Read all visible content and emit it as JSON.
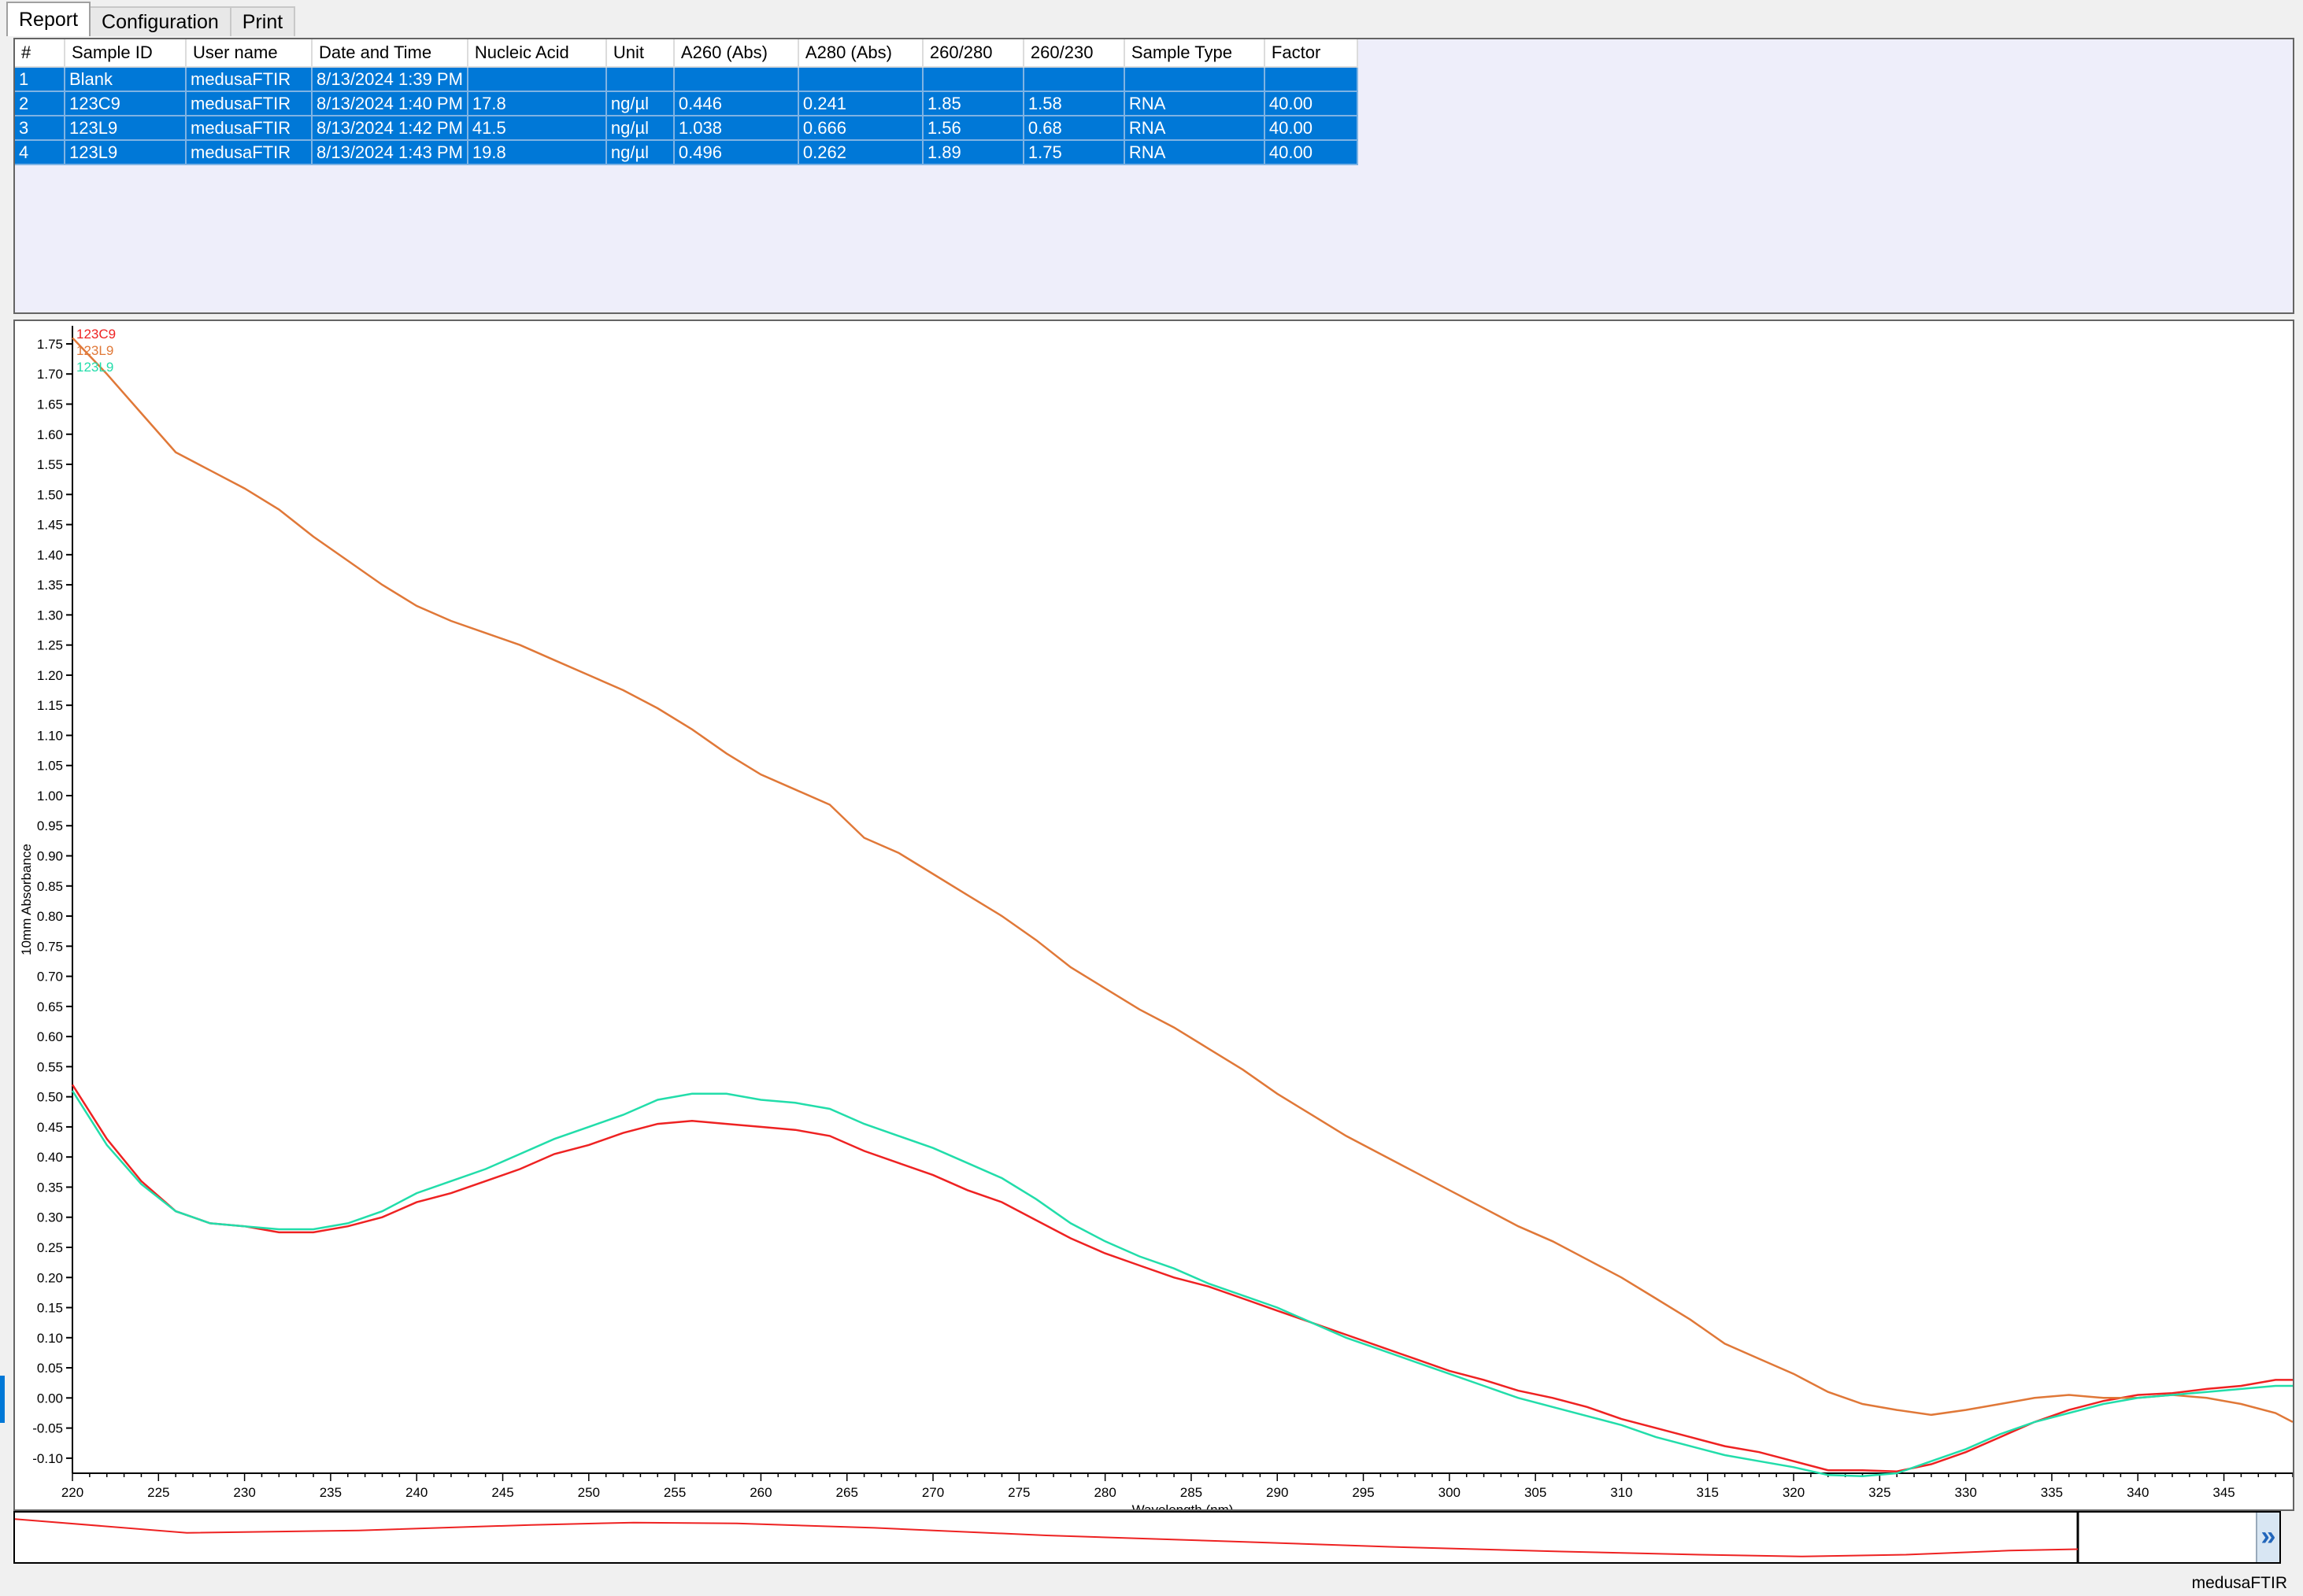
{
  "tabs": [
    {
      "label": "Report",
      "active": true
    },
    {
      "label": "Configuration",
      "active": false
    },
    {
      "label": "Print",
      "active": false
    }
  ],
  "table": {
    "columns": [
      "#",
      "Sample ID",
      "User name",
      "Date and Time",
      "Nucleic Acid",
      "Unit",
      "A260 (Abs)",
      "A280 (Abs)",
      "260/280",
      "260/230",
      "Sample Type",
      "Factor"
    ],
    "rows": [
      [
        "1",
        "Blank",
        "medusaFTIR",
        "8/13/2024 1:39 PM",
        "",
        "",
        "",
        "",
        "",
        "",
        "",
        ""
      ],
      [
        "2",
        "123C9",
        "medusaFTIR",
        "8/13/2024 1:40 PM",
        "17.8",
        "ng/µl",
        "0.446",
        "0.241",
        "1.85",
        "1.58",
        "RNA",
        "40.00"
      ],
      [
        "3",
        "123L9",
        "medusaFTIR",
        "8/13/2024 1:42 PM",
        "41.5",
        "ng/µl",
        "1.038",
        "0.666",
        "1.56",
        "0.68",
        "RNA",
        "40.00"
      ],
      [
        "4",
        "123L9",
        "medusaFTIR",
        "8/13/2024 1:43 PM",
        "19.8",
        "ng/µl",
        "0.496",
        "0.262",
        "1.89",
        "1.75",
        "RNA",
        "40.00"
      ]
    ]
  },
  "chart_data": {
    "type": "line",
    "xlabel": "Wavelength (nm)",
    "ylabel": "10mm Absorbance",
    "xlim": [
      220,
      349
    ],
    "ylim": [
      -0.125,
      1.78
    ],
    "xticks": [
      220,
      225,
      230,
      235,
      240,
      245,
      250,
      255,
      260,
      265,
      270,
      275,
      280,
      285,
      290,
      295,
      300,
      305,
      310,
      315,
      320,
      325,
      330,
      335,
      340,
      345
    ],
    "yticks": [
      -0.1,
      -0.05,
      0,
      0.05,
      0.1,
      0.15,
      0.2,
      0.25,
      0.3,
      0.35,
      0.4,
      0.45,
      0.5,
      0.55,
      0.6,
      0.65,
      0.7,
      0.75,
      0.8,
      0.85,
      0.9,
      0.95,
      1.0,
      1.05,
      1.1,
      1.15,
      1.2,
      1.25,
      1.3,
      1.35,
      1.4,
      1.45,
      1.5,
      1.55,
      1.6,
      1.65,
      1.7,
      1.75
    ],
    "grid": false,
    "legend": "top-left",
    "series": [
      {
        "name": "123C9",
        "color": "#ee2222",
        "points": [
          [
            220,
            0.52
          ],
          [
            222,
            0.43
          ],
          [
            224,
            0.36
          ],
          [
            226,
            0.31
          ],
          [
            228,
            0.29
          ],
          [
            230,
            0.285
          ],
          [
            232,
            0.275
          ],
          [
            234,
            0.275
          ],
          [
            236,
            0.285
          ],
          [
            238,
            0.3
          ],
          [
            240,
            0.325
          ],
          [
            242,
            0.34
          ],
          [
            244,
            0.36
          ],
          [
            246,
            0.38
          ],
          [
            248,
            0.405
          ],
          [
            250,
            0.42
          ],
          [
            252,
            0.44
          ],
          [
            254,
            0.455
          ],
          [
            256,
            0.46
          ],
          [
            258,
            0.455
          ],
          [
            260,
            0.45
          ],
          [
            262,
            0.445
          ],
          [
            264,
            0.435
          ],
          [
            266,
            0.41
          ],
          [
            268,
            0.39
          ],
          [
            270,
            0.37
          ],
          [
            272,
            0.345
          ],
          [
            274,
            0.325
          ],
          [
            276,
            0.295
          ],
          [
            278,
            0.265
          ],
          [
            280,
            0.24
          ],
          [
            282,
            0.22
          ],
          [
            284,
            0.2
          ],
          [
            286,
            0.185
          ],
          [
            288,
            0.165
          ],
          [
            290,
            0.145
          ],
          [
            292,
            0.125
          ],
          [
            294,
            0.105
          ],
          [
            296,
            0.085
          ],
          [
            298,
            0.065
          ],
          [
            300,
            0.045
          ],
          [
            302,
            0.03
          ],
          [
            304,
            0.012
          ],
          [
            306,
            0.0
          ],
          [
            308,
            -0.015
          ],
          [
            310,
            -0.035
          ],
          [
            312,
            -0.05
          ],
          [
            314,
            -0.065
          ],
          [
            316,
            -0.08
          ],
          [
            318,
            -0.09
          ],
          [
            320,
            -0.105
          ],
          [
            322,
            -0.12
          ],
          [
            324,
            -0.12
          ],
          [
            326,
            -0.122
          ],
          [
            328,
            -0.11
          ],
          [
            330,
            -0.09
          ],
          [
            332,
            -0.065
          ],
          [
            334,
            -0.04
          ],
          [
            336,
            -0.02
          ],
          [
            338,
            -0.005
          ],
          [
            340,
            0.005
          ],
          [
            342,
            0.008
          ],
          [
            344,
            0.015
          ],
          [
            346,
            0.02
          ],
          [
            348,
            0.03
          ],
          [
            349,
            0.03
          ]
        ]
      },
      {
        "name": "123L9",
        "color": "#e07838",
        "points": [
          [
            220,
            1.76
          ],
          [
            222,
            1.7
          ],
          [
            224,
            1.635
          ],
          [
            226,
            1.57
          ],
          [
            228,
            1.54
          ],
          [
            230,
            1.51
          ],
          [
            232,
            1.475
          ],
          [
            234,
            1.43
          ],
          [
            236,
            1.39
          ],
          [
            238,
            1.35
          ],
          [
            240,
            1.315
          ],
          [
            242,
            1.29
          ],
          [
            244,
            1.27
          ],
          [
            246,
            1.25
          ],
          [
            248,
            1.225
          ],
          [
            250,
            1.2
          ],
          [
            252,
            1.175
          ],
          [
            254,
            1.145
          ],
          [
            256,
            1.11
          ],
          [
            258,
            1.07
          ],
          [
            260,
            1.035
          ],
          [
            262,
            1.01
          ],
          [
            264,
            0.985
          ],
          [
            266,
            0.93
          ],
          [
            268,
            0.905
          ],
          [
            270,
            0.87
          ],
          [
            272,
            0.835
          ],
          [
            274,
            0.8
          ],
          [
            276,
            0.76
          ],
          [
            278,
            0.715
          ],
          [
            280,
            0.68
          ],
          [
            282,
            0.645
          ],
          [
            284,
            0.615
          ],
          [
            286,
            0.58
          ],
          [
            288,
            0.545
          ],
          [
            290,
            0.505
          ],
          [
            292,
            0.47
          ],
          [
            294,
            0.435
          ],
          [
            296,
            0.405
          ],
          [
            298,
            0.375
          ],
          [
            300,
            0.345
          ],
          [
            302,
            0.315
          ],
          [
            304,
            0.285
          ],
          [
            306,
            0.26
          ],
          [
            308,
            0.23
          ],
          [
            310,
            0.2
          ],
          [
            312,
            0.165
          ],
          [
            314,
            0.13
          ],
          [
            316,
            0.09
          ],
          [
            318,
            0.065
          ],
          [
            320,
            0.04
          ],
          [
            322,
            0.01
          ],
          [
            324,
            -0.01
          ],
          [
            326,
            -0.02
          ],
          [
            328,
            -0.028
          ],
          [
            330,
            -0.02
          ],
          [
            332,
            -0.01
          ],
          [
            334,
            0.0
          ],
          [
            336,
            0.005
          ],
          [
            338,
            0.0
          ],
          [
            340,
            0.0
          ],
          [
            342,
            0.005
          ],
          [
            344,
            0.0
          ],
          [
            346,
            -0.01
          ],
          [
            348,
            -0.025
          ],
          [
            349,
            -0.04
          ]
        ]
      },
      {
        "name": "123L9",
        "color": "#22ddaa",
        "points": [
          [
            220,
            0.51
          ],
          [
            222,
            0.42
          ],
          [
            224,
            0.355
          ],
          [
            226,
            0.31
          ],
          [
            228,
            0.29
          ],
          [
            230,
            0.285
          ],
          [
            232,
            0.28
          ],
          [
            234,
            0.28
          ],
          [
            236,
            0.29
          ],
          [
            238,
            0.31
          ],
          [
            240,
            0.34
          ],
          [
            242,
            0.36
          ],
          [
            244,
            0.38
          ],
          [
            246,
            0.405
          ],
          [
            248,
            0.43
          ],
          [
            250,
            0.45
          ],
          [
            252,
            0.47
          ],
          [
            254,
            0.495
          ],
          [
            256,
            0.505
          ],
          [
            258,
            0.505
          ],
          [
            260,
            0.495
          ],
          [
            262,
            0.49
          ],
          [
            264,
            0.48
          ],
          [
            266,
            0.455
          ],
          [
            268,
            0.435
          ],
          [
            270,
            0.415
          ],
          [
            272,
            0.39
          ],
          [
            274,
            0.365
          ],
          [
            276,
            0.33
          ],
          [
            278,
            0.29
          ],
          [
            280,
            0.26
          ],
          [
            282,
            0.235
          ],
          [
            284,
            0.215
          ],
          [
            286,
            0.19
          ],
          [
            288,
            0.17
          ],
          [
            290,
            0.15
          ],
          [
            292,
            0.125
          ],
          [
            294,
            0.1
          ],
          [
            296,
            0.08
          ],
          [
            298,
            0.06
          ],
          [
            300,
            0.04
          ],
          [
            302,
            0.02
          ],
          [
            304,
            0.0
          ],
          [
            306,
            -0.015
          ],
          [
            308,
            -0.03
          ],
          [
            310,
            -0.045
          ],
          [
            312,
            -0.065
          ],
          [
            314,
            -0.08
          ],
          [
            316,
            -0.095
          ],
          [
            318,
            -0.105
          ],
          [
            320,
            -0.115
          ],
          [
            322,
            -0.128
          ],
          [
            324,
            -0.13
          ],
          [
            326,
            -0.125
          ],
          [
            328,
            -0.105
          ],
          [
            330,
            -0.085
          ],
          [
            332,
            -0.06
          ],
          [
            334,
            -0.04
          ],
          [
            336,
            -0.025
          ],
          [
            338,
            -0.01
          ],
          [
            340,
            0.0
          ],
          [
            342,
            0.005
          ],
          [
            344,
            0.01
          ],
          [
            346,
            0.015
          ],
          [
            348,
            0.02
          ],
          [
            349,
            0.02
          ]
        ]
      }
    ]
  },
  "overview": {
    "color": "#ee2222",
    "points": [
      [
        220,
        0.52
      ],
      [
        230,
        0.285
      ],
      [
        240,
        0.325
      ],
      [
        250,
        0.42
      ],
      [
        256,
        0.46
      ],
      [
        262,
        0.445
      ],
      [
        270,
        0.37
      ],
      [
        280,
        0.24
      ],
      [
        290,
        0.145
      ],
      [
        300,
        0.045
      ],
      [
        310,
        -0.035
      ],
      [
        318,
        -0.09
      ],
      [
        324,
        -0.12
      ],
      [
        330,
        -0.09
      ],
      [
        336,
        -0.02
      ],
      [
        340,
        0.005
      ]
    ]
  },
  "status": {
    "user": "medusaFTIR"
  }
}
